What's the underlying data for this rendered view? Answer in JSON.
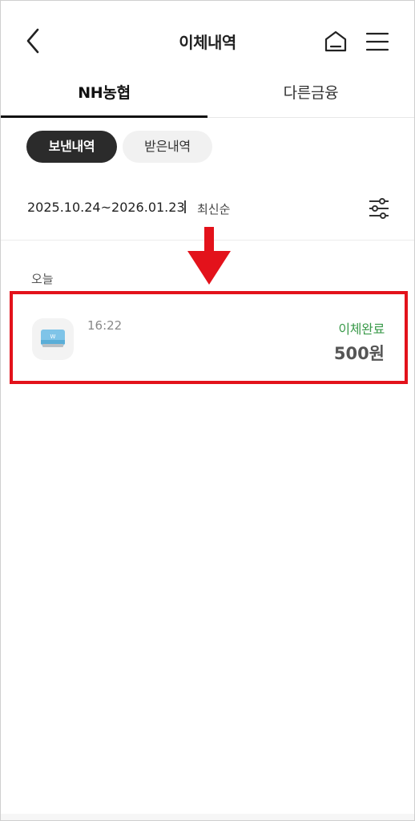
{
  "header": {
    "title": "이체내역",
    "back_icon": "chevron-left-icon",
    "home_icon": "home-icon",
    "menu_icon": "hamburger-menu-icon"
  },
  "tabs": [
    {
      "label": "NH농협",
      "selected": true
    },
    {
      "label": "다른금융",
      "selected": false
    }
  ],
  "chips": [
    {
      "label": "보낸내역",
      "selected": true
    },
    {
      "label": "받은내역",
      "selected": false
    }
  ],
  "filter": {
    "date_range": "2025.10.24~2026.01.23",
    "sort": "최신순",
    "filter_icon": "sliders-icon"
  },
  "groups": [
    {
      "day_label": "오늘",
      "transactions": [
        {
          "time": "16:22",
          "status": "이체완료",
          "amount": "500원",
          "icon": "bank-card-icon"
        }
      ]
    }
  ],
  "colors": {
    "status_green": "#3a9a4a",
    "highlight_red": "#e3121b",
    "chip_dark": "#2b2b2b",
    "chip_light": "#f1f1f1"
  }
}
